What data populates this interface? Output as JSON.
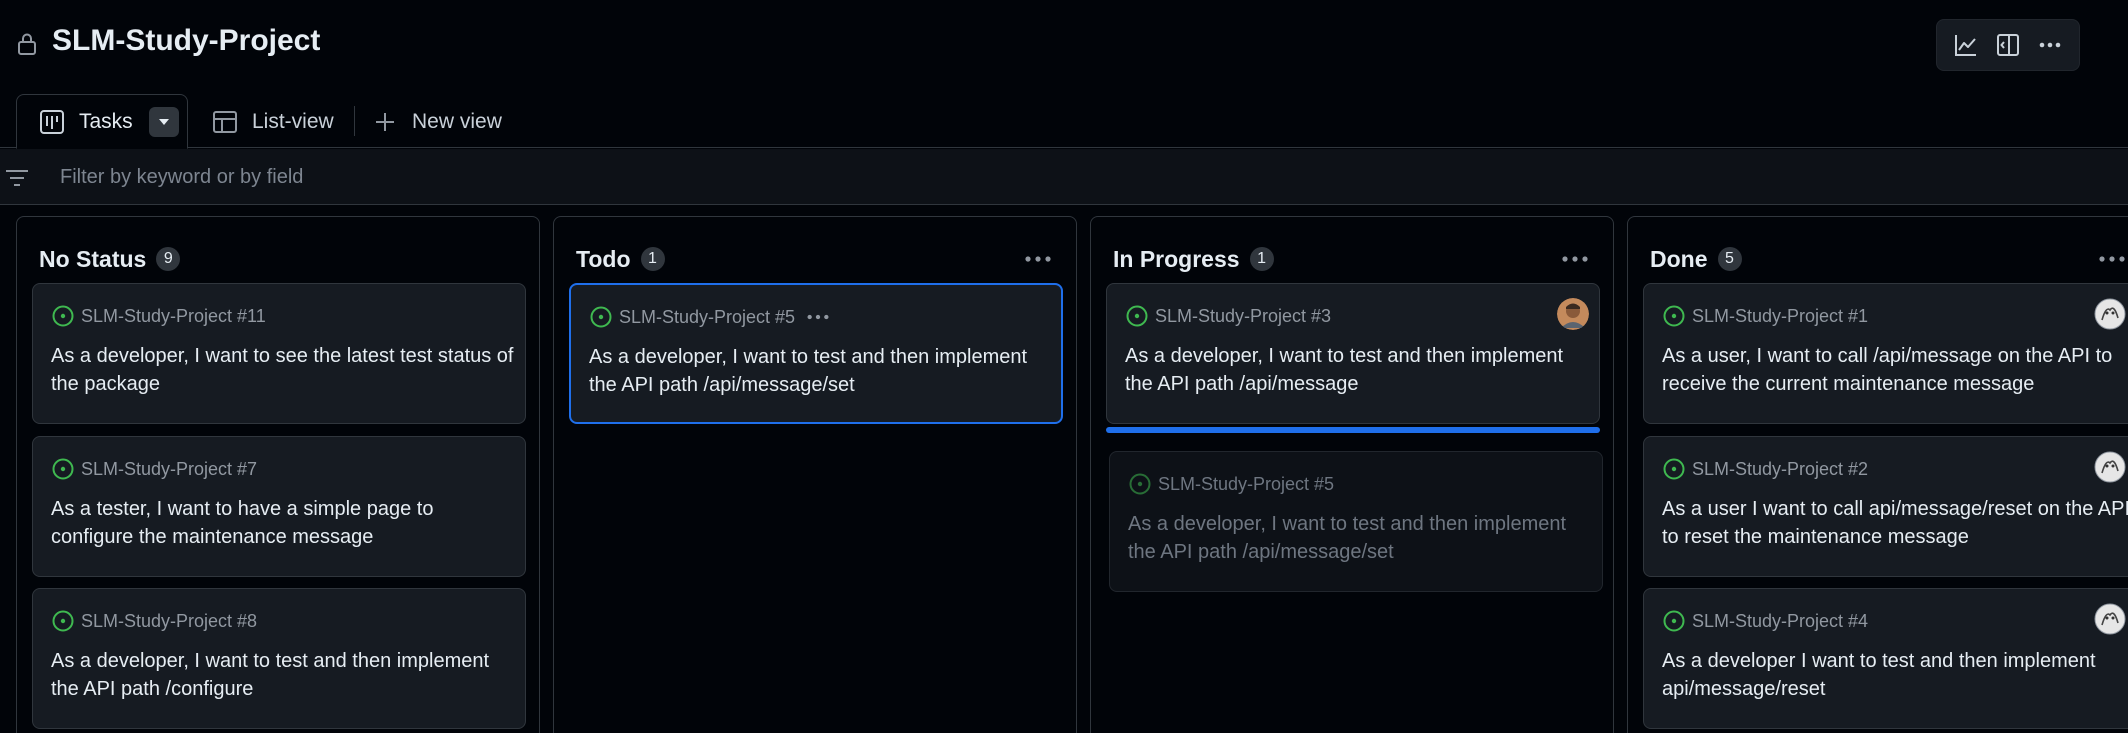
{
  "header": {
    "title": "SLM-Study-Project",
    "tools": [
      "insights-icon",
      "side-panel-icon",
      "more-options-icon"
    ]
  },
  "tabs": [
    {
      "label": "Tasks",
      "icon": "board-icon",
      "active": true
    },
    {
      "label": "List-view",
      "icon": "table-icon",
      "active": false
    },
    {
      "label": "New view",
      "icon": "plus-icon",
      "active": false
    }
  ],
  "filter": {
    "placeholder": "Filter by keyword or by field",
    "value": ""
  },
  "colors": {
    "background": "#010409",
    "card": "#161b22",
    "border": "#30363d",
    "accent": "#1f6feb",
    "open_status": "#3fb950"
  },
  "columns": [
    {
      "name": "No Status",
      "count": "9",
      "cards": [
        {
          "ref": "SLM-Study-Project #11",
          "title": "As a developer, I want to see the latest test status of the package"
        },
        {
          "ref": "SLM-Study-Project #7",
          "title": "As a tester, I want to have a simple page to configure the maintenance message"
        },
        {
          "ref": "SLM-Study-Project #8",
          "title": "As a developer, I want to test and then implement the API path /configure"
        }
      ]
    },
    {
      "name": "Todo",
      "count": "1",
      "cards": [
        {
          "ref": "SLM-Study-Project #5",
          "title": "As a developer, I want to test and then implement the API path /api/message/set"
        }
      ]
    },
    {
      "name": "In Progress",
      "count": "1",
      "cards": [
        {
          "ref": "SLM-Study-Project #3",
          "title": "As a developer, I want to test and then implement the API path /api/message"
        },
        {
          "ref": "SLM-Study-Project #5",
          "title": "As a developer, I want to test and then implement the API path /api/message/set"
        }
      ]
    },
    {
      "name": "Done",
      "count": "5",
      "cards": [
        {
          "ref": "SLM-Study-Project #1",
          "title": "As a user, I want to call /api/message on the API to receive the current maintenance message"
        },
        {
          "ref": "SLM-Study-Project #2",
          "title": "As a user I want to call api/message/reset on the API to reset the maintenance message"
        },
        {
          "ref": "SLM-Study-Project #4",
          "title": "As a developer I want to test and then implement api/message/reset"
        }
      ]
    }
  ]
}
